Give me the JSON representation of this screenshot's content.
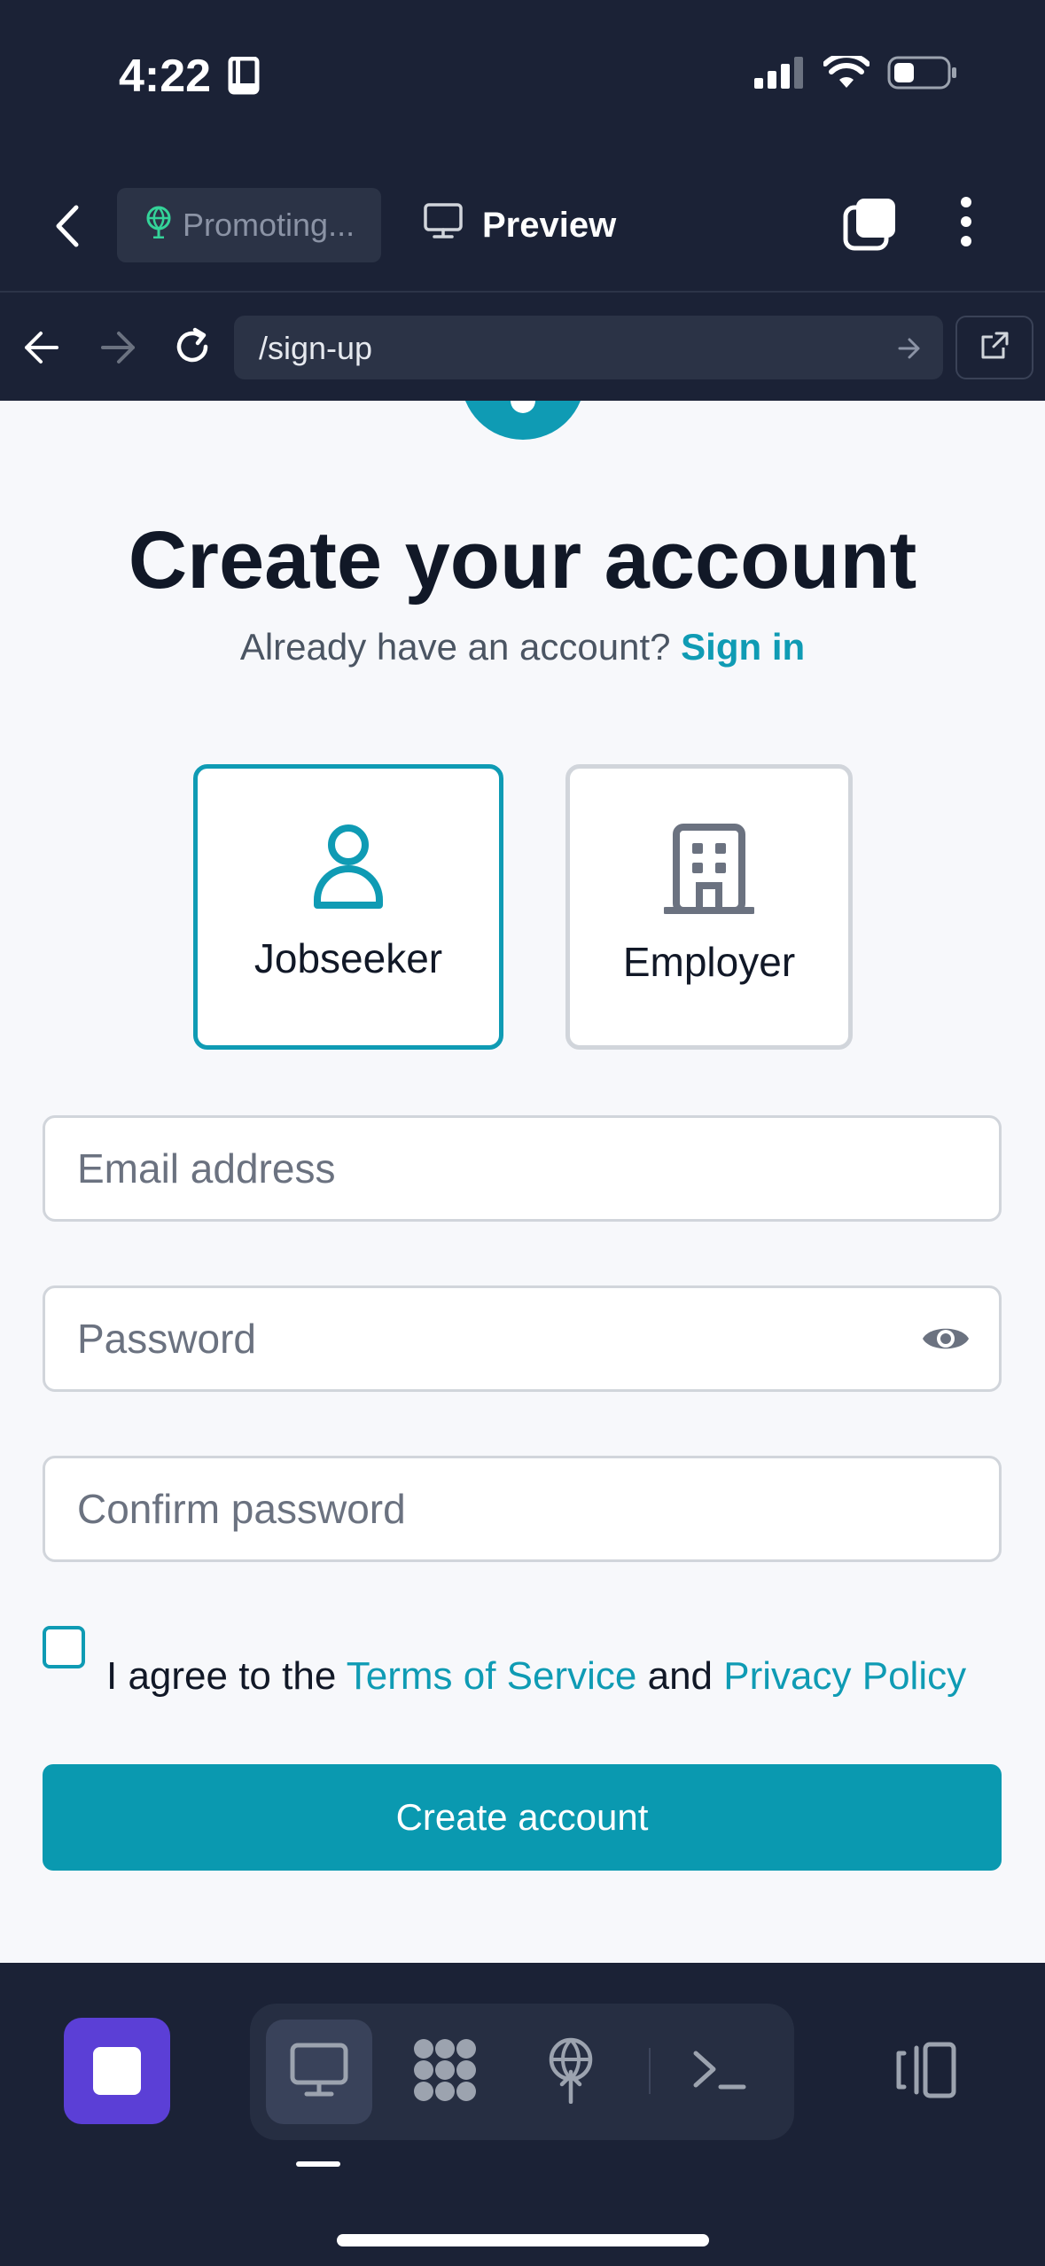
{
  "status_bar": {
    "time": "4:22",
    "icons": [
      "book-icon",
      "cellular-signal-icon",
      "wifi-icon",
      "battery-icon"
    ]
  },
  "header": {
    "back_icon": "chevron-left-icon",
    "promo_label": "Promoting...",
    "promo_icon": "globe-antenna-icon",
    "preview_label": "Preview",
    "preview_icon": "monitor-icon",
    "tabs_icon": "tabs-icon",
    "menu_icon": "kebab-icon"
  },
  "browser": {
    "url": "/sign-up",
    "icons": [
      "arrow-left-icon",
      "arrow-right-icon",
      "reload-icon",
      "arrow-right-icon",
      "open-external-icon"
    ]
  },
  "page": {
    "title": "Create your account",
    "subtitle_prefix": "Already have an account?",
    "sign_in_link": "Sign in",
    "roles": [
      {
        "label": "Jobseeker",
        "icon": "user-icon",
        "selected": true
      },
      {
        "label": "Employer",
        "icon": "building-icon",
        "selected": false
      }
    ],
    "email_placeholder": "Email address",
    "password_placeholder": "Password",
    "confirm_placeholder": "Confirm password",
    "terms": {
      "prefix": "I agree to the",
      "tos_link": "Terms of Service",
      "middle": "and",
      "privacy_link": "Privacy Policy",
      "checked": false
    },
    "submit_label": "Create account"
  },
  "colors": {
    "accent": "#0f9bb4",
    "header_bg": "#1b2236",
    "page_bg": "#f7f8fb",
    "stop_button": "#5b3fd6"
  },
  "bottom_bar": {
    "icons": [
      "stop-icon",
      "desktop-icon",
      "apps-grid-icon",
      "globe-antenna-icon",
      "terminal-icon",
      "device-toggle-icon"
    ],
    "active_tool": "desktop-icon"
  }
}
